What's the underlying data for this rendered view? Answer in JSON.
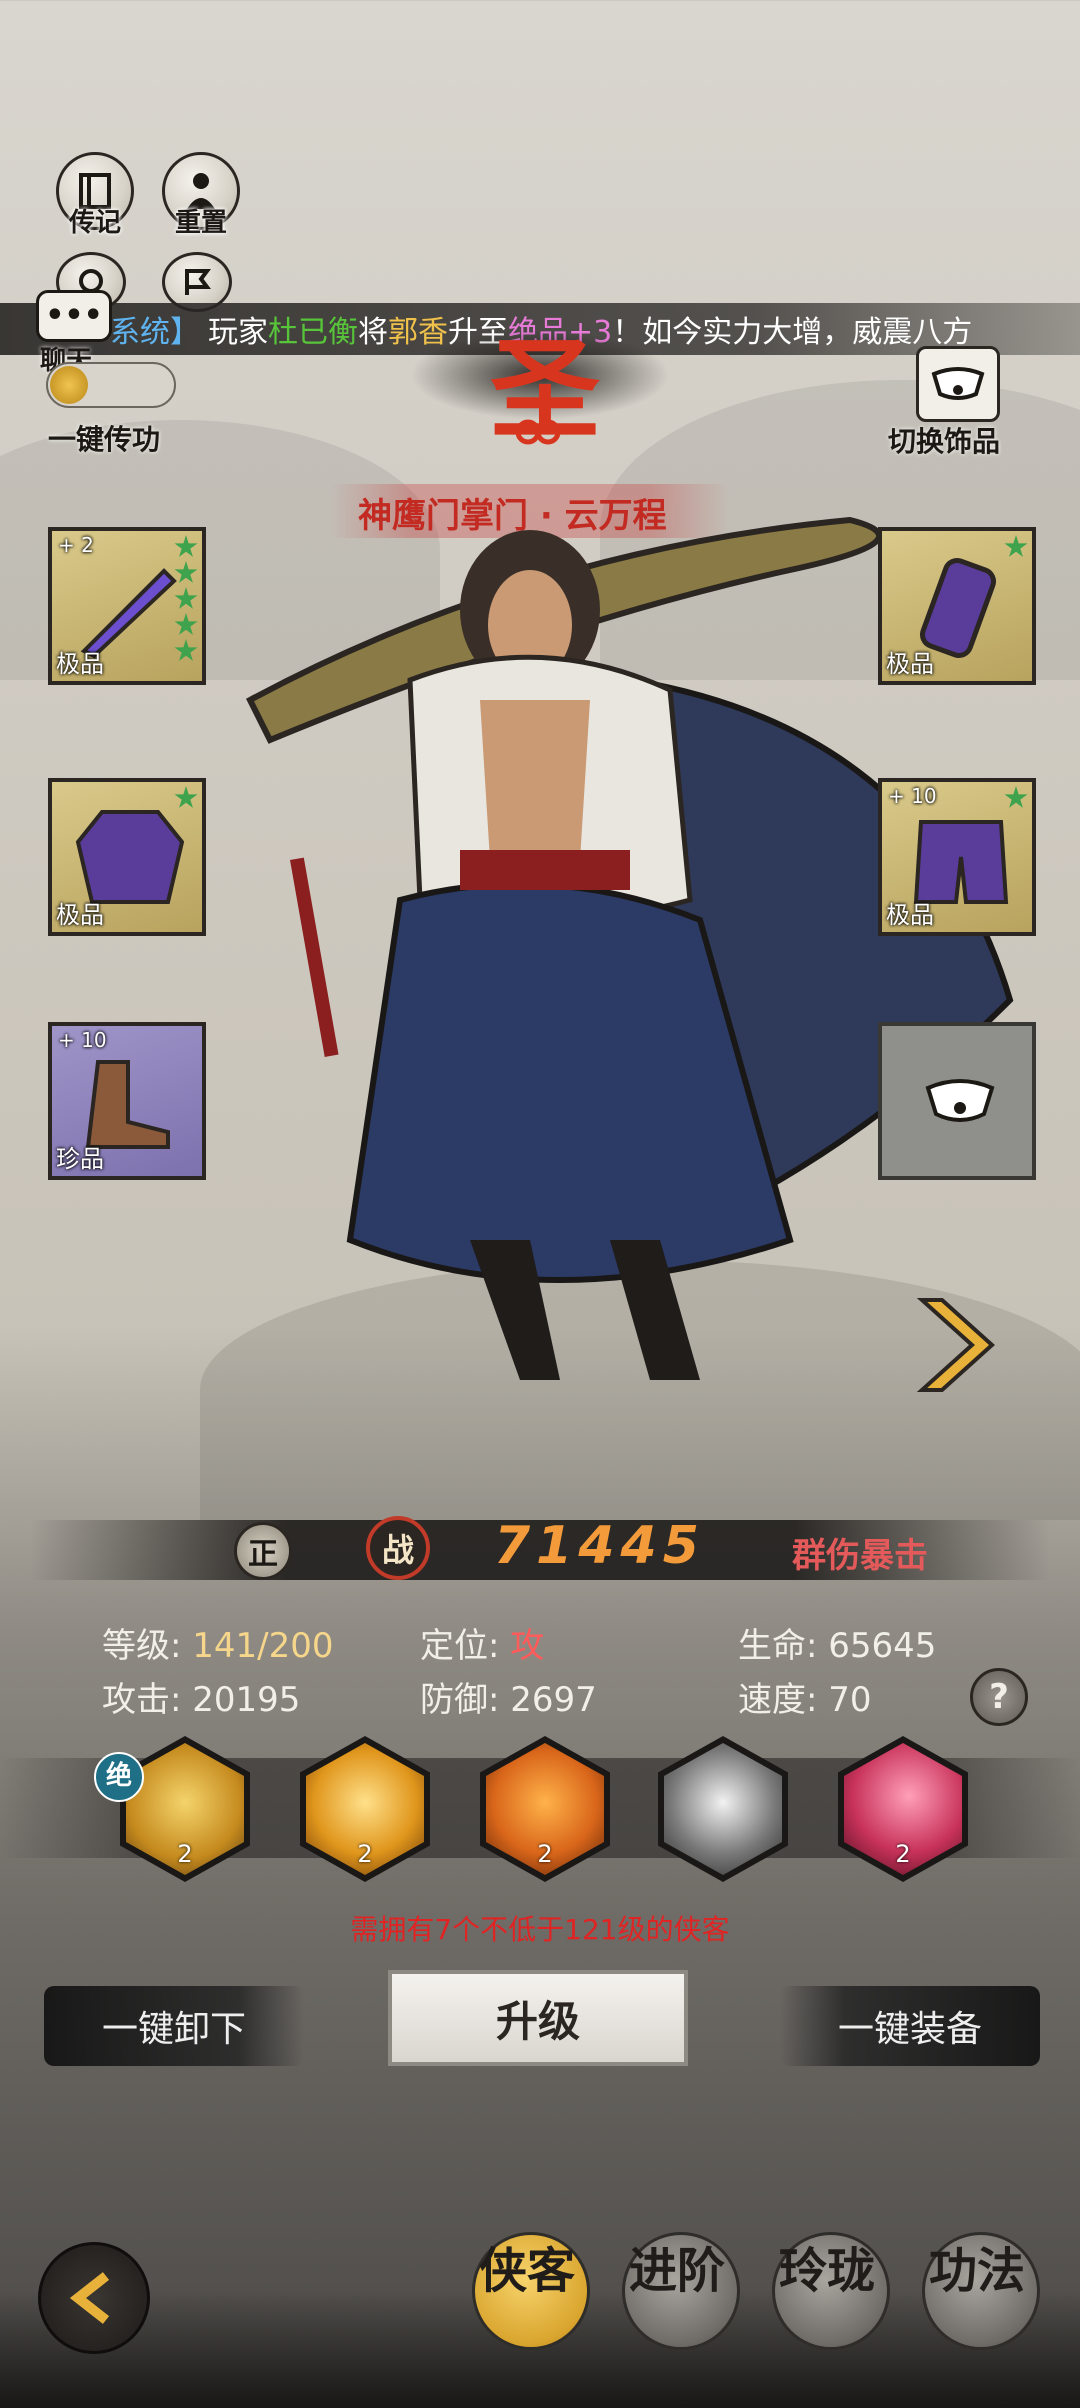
{
  "top_buttons": [
    {
      "label": "传记",
      "icon": "book-icon"
    },
    {
      "label": "重置",
      "icon": "figure-icon"
    },
    {
      "label": "",
      "icon": "scroll-icon"
    },
    {
      "label": "",
      "icon": "flag-icon"
    }
  ],
  "chat": {
    "label": "聊天"
  },
  "pass_skill": {
    "label": "一键传功"
  },
  "ticker": {
    "prefix": "系统】",
    "p1": "玩家",
    "player": "杜已衡",
    "p2": "将",
    "target": "郭香",
    "p3": "升至",
    "grade": "绝品+3",
    "p4": "！如今实力大增，威震八方"
  },
  "rank_char": "圣",
  "switch_accessory": {
    "label": "切换饰品"
  },
  "hero_title": "神鹰门掌门 · 云万程",
  "equipment": {
    "weapon": {
      "quality": "极品",
      "plus": "+ 2",
      "stars": 5
    },
    "armor": {
      "quality": "极品",
      "stars": 1
    },
    "boots": {
      "quality": "珍品",
      "plus": "+ 10",
      "stars": 0
    },
    "bracer": {
      "quality": "极品",
      "stars": 1
    },
    "pants": {
      "quality": "极品",
      "plus": "+ 10",
      "stars": 1
    }
  },
  "alignment": "正",
  "power": {
    "label": "战",
    "value": "71445"
  },
  "role_tag": "群伤暴击",
  "stats": {
    "level_label": "等级:",
    "level_value": "141/200",
    "position_label": "定位:",
    "position_value": "攻",
    "hp_label": "生命:",
    "hp_value": "65645",
    "attack_label": "攻击:",
    "attack_value": "20195",
    "defense_label": "防御:",
    "defense_value": "2697",
    "speed_label": "速度:",
    "speed_value": "70"
  },
  "help": "?",
  "skills": [
    {
      "badge": "绝",
      "level": "2",
      "color": "#c58a1e"
    },
    {
      "badge": "",
      "level": "2",
      "color": "#e0961c"
    },
    {
      "badge": "",
      "level": "2",
      "color": "#d9661a"
    },
    {
      "badge": "",
      "level": "",
      "color": "#7a7a7a"
    },
    {
      "badge": "",
      "level": "2",
      "color": "#c8325a"
    }
  ],
  "requirement": "需拥有7个不低于121级的侠客",
  "buttons": {
    "unequip_all": "一键卸下",
    "upgrade": "升级",
    "equip_all": "一键装备"
  },
  "tabs": [
    "侠客",
    "进阶",
    "玲珑",
    "功法"
  ],
  "colors": {
    "accent_gold": "#e8b23a",
    "player_green": "#57c43a",
    "grade_pink": "#e87bd8",
    "requirement_red": "#d61f1f"
  }
}
